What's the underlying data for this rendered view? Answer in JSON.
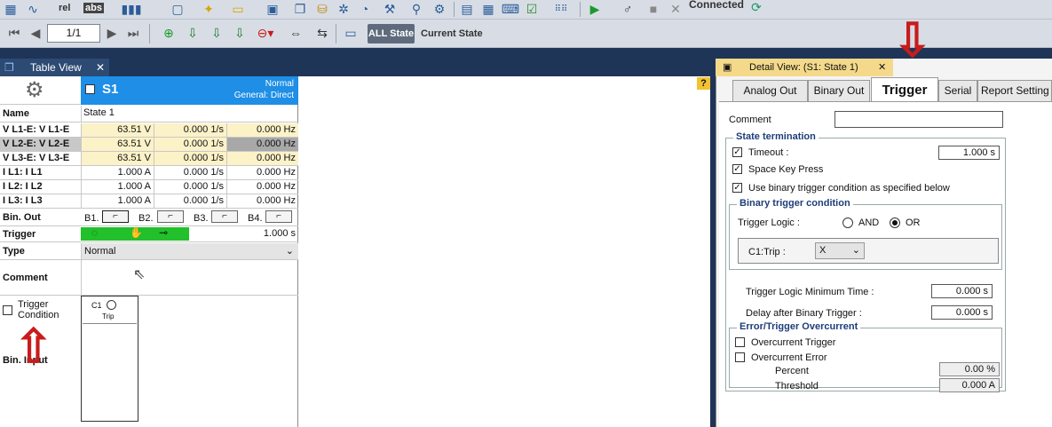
{
  "toolbar": {
    "rel_label": "rel",
    "abs_label": "abs",
    "connected_label": "Connected",
    "page_value": "1/1",
    "all_state_label": "ALL State",
    "current_state_label": "Current State"
  },
  "table_view": {
    "tab_title": "Table View",
    "state_title": "S1",
    "state_mode": "Normal",
    "state_general": "General: Direct",
    "name_label": "Name",
    "name_value": "State 1",
    "rows": [
      {
        "label": "V L1-E: V L1-E",
        "c1": "63.51 V",
        "c2": "0.000 1/s",
        "c3": "0.000 Hz"
      },
      {
        "label": "V L2-E: V L2-E",
        "c1": "63.51 V",
        "c2": "0.000 1/s",
        "c3": "0.000 Hz"
      },
      {
        "label": "V L3-E: V L3-E",
        "c1": "63.51 V",
        "c2": "0.000 1/s",
        "c3": "0.000 Hz"
      },
      {
        "label": "I L1: I L1",
        "c1": "1.000 A",
        "c2": "0.000 1/s",
        "c3": "0.000 Hz"
      },
      {
        "label": "I L2: I L2",
        "c1": "1.000 A",
        "c2": "0.000 1/s",
        "c3": "0.000 Hz"
      },
      {
        "label": "I L3: I L3",
        "c1": "1.000 A",
        "c2": "0.000 1/s",
        "c3": "0.000 Hz"
      }
    ],
    "binout_label": "Bin. Out",
    "binout_items": [
      "B1.",
      "B2.",
      "B3.",
      "B4."
    ],
    "trigger_label": "Trigger",
    "trigger_value": "1.000 s",
    "type_label": "Type",
    "type_value": "Normal",
    "comment_label": "Comment",
    "trigger_condition_label": "Trigger Condition",
    "bin_input_label": "Bin. Input",
    "c1_label": "C1",
    "trip_label": "Trip"
  },
  "detail_view": {
    "tab_title": "Detail View: (S1: State 1)",
    "tabs": [
      "Analog Out",
      "Binary Out",
      "Trigger",
      "Serial",
      "Report Setting"
    ],
    "comment_label": "Comment",
    "state_termination_title": "State termination",
    "timeout_label": "Timeout :",
    "timeout_value": "1.000 s",
    "space_key_label": "Space Key Press",
    "use_binary_label": "Use binary trigger condition as specified below",
    "binary_trigger_title": "Binary trigger condition",
    "trigger_logic_label": "Trigger Logic :",
    "and_label": "AND",
    "or_label": "OR",
    "c1trip_label": "C1:Trip :",
    "c1trip_value": "X",
    "min_time_label": "Trigger Logic Minimum Time :",
    "min_time_value": "0.000 s",
    "delay_label": "Delay after Binary Trigger :",
    "delay_value": "0.000 s",
    "error_title": "Error/Trigger Overcurrent",
    "overcurrent_trigger_label": "Overcurrent Trigger",
    "overcurrent_error_label": "Overcurrent Error",
    "percent_label": "Percent",
    "percent_value": "0.00 %",
    "threshold_label": "Threshold",
    "threshold_value": "0.000 A"
  },
  "colors": {
    "state_header": "#1e8ee6",
    "trigger_green": "#22c02a",
    "highlight_yellow": "#fcf2c8",
    "arrow_red": "#c81c1c"
  }
}
